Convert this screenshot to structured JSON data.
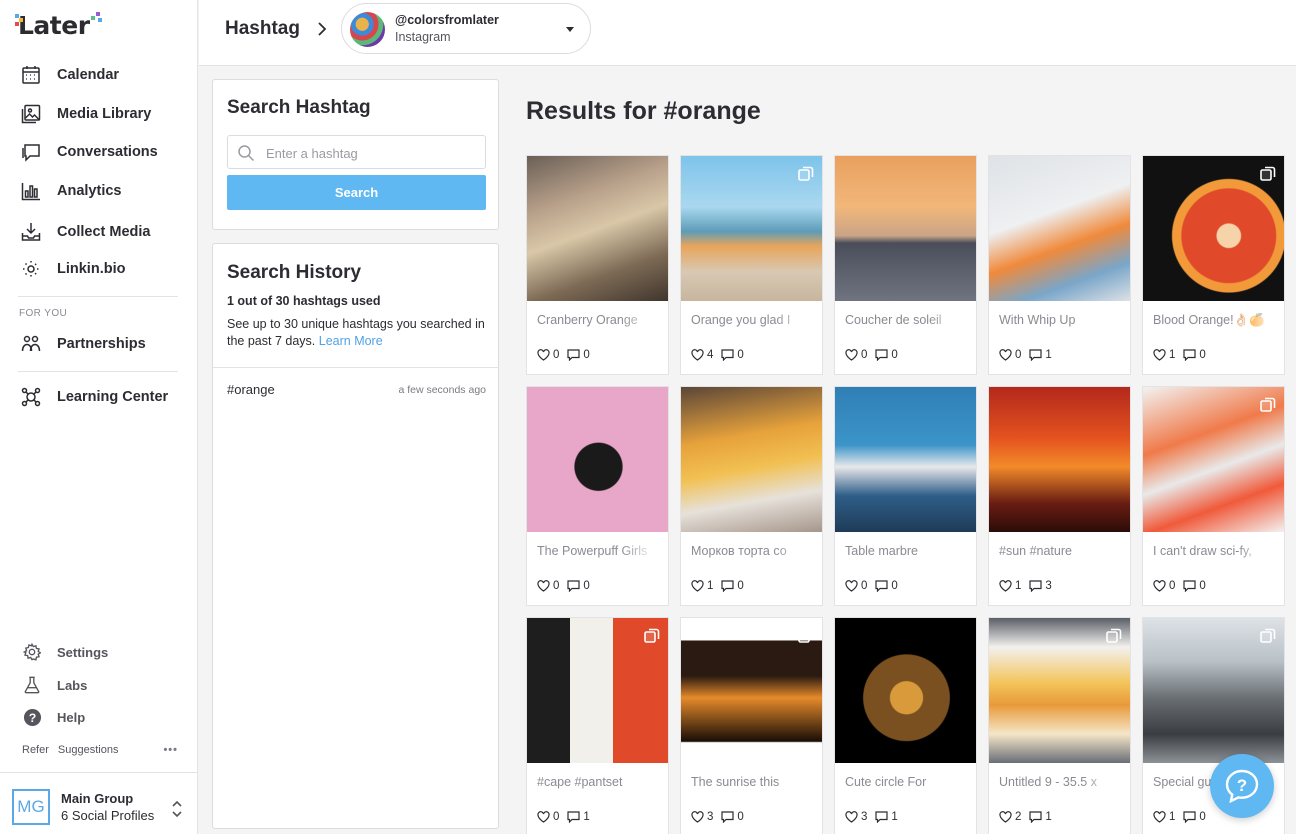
{
  "app": {
    "logo": "Later"
  },
  "sidebar": {
    "items": [
      {
        "label": "Calendar",
        "icon": "calendar-icon"
      },
      {
        "label": "Media Library",
        "icon": "media-library-icon"
      },
      {
        "label": "Conversations",
        "icon": "conversations-icon"
      },
      {
        "label": "Analytics",
        "icon": "analytics-icon"
      },
      {
        "label": "Collect Media",
        "icon": "collect-media-icon"
      },
      {
        "label": "Linkin.bio",
        "icon": "linkin-bio-icon"
      }
    ],
    "section_label": "FOR YOU",
    "partnerships": "Partnerships",
    "learning_center": "Learning Center",
    "bottom": {
      "settings": "Settings",
      "labs": "Labs",
      "help": "Help",
      "refer": "Refer",
      "suggestions": "Suggestions",
      "more": "•••"
    },
    "group": {
      "initials": "MG",
      "name": "Main Group",
      "profiles": "6 Social Profiles"
    }
  },
  "header": {
    "breadcrumb": "Hashtag",
    "account": {
      "handle": "@colorsfromlater",
      "network": "Instagram"
    }
  },
  "search_panel": {
    "title": "Search Hashtag",
    "placeholder": "Enter a hashtag",
    "button": "Search"
  },
  "history_panel": {
    "title": "Search History",
    "used": "1 out of 30 hashtags used",
    "description": "See up to 30 unique hashtags you searched in the past 7 days.",
    "learn_more": "Learn More",
    "entries": [
      {
        "tag": "#orange",
        "time": "a few seconds ago"
      }
    ]
  },
  "results": {
    "title": "Results for #orange",
    "posts": [
      {
        "caption": "Cranberry Orange",
        "likes": "0",
        "comments": "0",
        "multi": false
      },
      {
        "caption": "Orange you glad I",
        "likes": "4",
        "comments": "0",
        "multi": true
      },
      {
        "caption": "Coucher de soleil",
        "likes": "0",
        "comments": "0",
        "multi": false
      },
      {
        "caption": "With Whip Up",
        "likes": "0",
        "comments": "1",
        "multi": false
      },
      {
        "caption": "Blood Orange!👌🏻🍊",
        "likes": "1",
        "comments": "0",
        "multi": true
      },
      {
        "caption": "The Powerpuff Girls",
        "likes": "0",
        "comments": "0",
        "multi": false
      },
      {
        "caption": "Морков торта со",
        "likes": "1",
        "comments": "0",
        "multi": false
      },
      {
        "caption": "Table marbre",
        "likes": "0",
        "comments": "0",
        "multi": false
      },
      {
        "caption": "#sun #nature",
        "likes": "1",
        "comments": "3",
        "multi": false
      },
      {
        "caption": "I can't draw sci-fy,",
        "likes": "0",
        "comments": "0",
        "multi": true
      },
      {
        "caption": "#cape #pantset",
        "likes": "0",
        "comments": "1",
        "multi": true
      },
      {
        "caption": "The sunrise this",
        "likes": "3",
        "comments": "0",
        "multi": true
      },
      {
        "caption": "Cute circle For",
        "likes": "3",
        "comments": "1",
        "multi": false
      },
      {
        "caption": "Untitled 9 - 35.5 x",
        "likes": "2",
        "comments": "1",
        "multi": true
      },
      {
        "caption": "Special guest",
        "likes": "1",
        "comments": "0",
        "multi": true
      }
    ]
  },
  "help_widget": {
    "icon": "question-icon",
    "symbol": "?"
  },
  "colors": {
    "accent": "#5fb8f2",
    "link": "#4fa3e6",
    "text": "#2c2c32"
  }
}
